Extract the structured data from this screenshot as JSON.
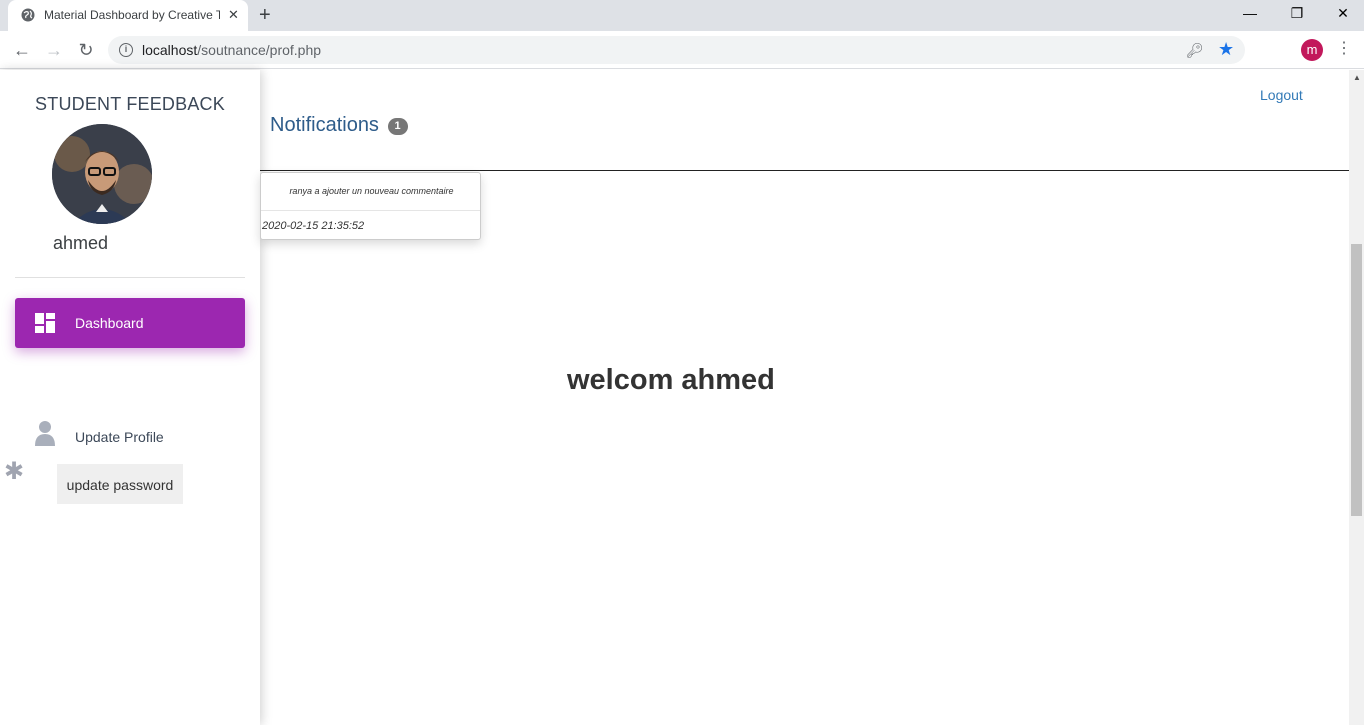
{
  "browser": {
    "tab_title": "Material Dashboard by Creative Tim",
    "new_tab": "+",
    "close_tab": "✕",
    "url_host": "localhost",
    "url_path": "/soutnance/prof.php",
    "profile_initial": "m",
    "window_controls": {
      "minimize": "—",
      "restore": "❐",
      "close": "✕"
    },
    "nav": {
      "back": "←",
      "forward": "→",
      "reload": "↻"
    },
    "menu": "⋮"
  },
  "sidebar": {
    "brand": "STUDENT FEEDBACK",
    "username": "ahmed",
    "active_item": "Dashboard",
    "profile_item": "Update Profile",
    "password_button": "update password",
    "gear_glyph": "✱"
  },
  "topnav": {
    "notifications_label": "Notifications",
    "notifications_count": "1",
    "logout_label": "Logout"
  },
  "notification": {
    "message": "ranya a ajouter un nouveau commentaire",
    "date": "2020-02-15 21:35:52"
  },
  "main": {
    "welcome": "welcom ahmed"
  }
}
